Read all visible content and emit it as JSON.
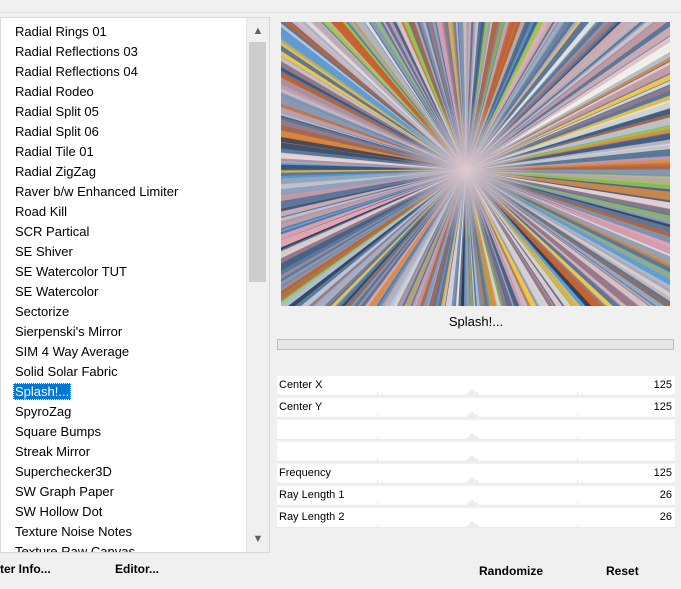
{
  "filter_list": {
    "items": [
      "Radial  Rings 01",
      "Radial Reflections 03",
      "Radial Reflections 04",
      "Radial Rodeo",
      "Radial Split 05",
      "Radial Split 06",
      "Radial Tile 01",
      "Radial ZigZag",
      "Raver b/w Enhanced Limiter",
      "Road Kill",
      "SCR  Partical",
      "SE Shiver",
      "SE Watercolor TUT",
      "SE Watercolor",
      "Sectorize",
      "Sierpenski's Mirror",
      "SIM 4 Way Average",
      "Solid Solar Fabric",
      "Splash!...",
      "SpyroZag",
      "Square Bumps",
      "Streak Mirror",
      "Superchecker3D",
      "SW Graph Paper",
      "SW Hollow Dot",
      "Texture Noise Notes",
      "Texture Raw Canvas"
    ],
    "selected_index": 18
  },
  "icons": {
    "scroll_up": "chevron-up-icon",
    "scroll_down": "chevron-down-icon"
  },
  "bottom_left": {
    "filter_info_label": "ter Info...",
    "editor_label": "Editor..."
  },
  "preview": {
    "filter_name": "Splash!..."
  },
  "params": [
    {
      "label": "Center X",
      "value": "125"
    },
    {
      "label": "Center Y",
      "value": "125"
    },
    {
      "label": "",
      "value": ""
    },
    {
      "label": "",
      "value": ""
    },
    {
      "label": "Frequency",
      "value": "125"
    },
    {
      "label": "Ray Length 1",
      "value": "26"
    },
    {
      "label": "Ray Length 2",
      "value": "26"
    }
  ],
  "bottom_right": {
    "randomize_label": "Randomize",
    "reset_label": "Reset"
  },
  "colors": {
    "selection": "#0078d7",
    "preview_base": "#5d7798"
  }
}
